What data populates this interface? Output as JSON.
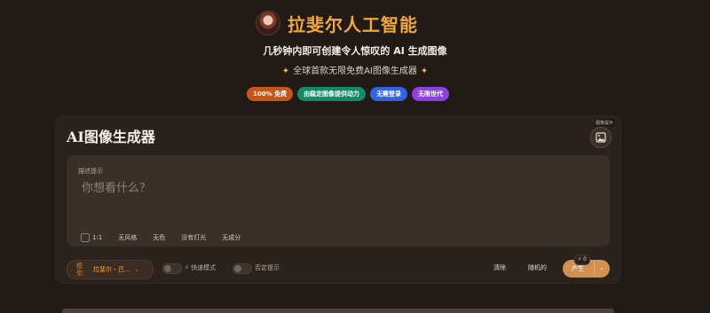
{
  "header": {
    "title": "拉斐尔人工智能",
    "tagline": "几秒钟内即可创建令人惊叹的 AI 生成图像",
    "subtitle": "全球首款无限免费AI图像生成器",
    "badges": [
      {
        "label": "100% 免费",
        "color": "#c4561a"
      },
      {
        "label": "由稳定图像提供动力",
        "color": "#118a65"
      },
      {
        "label": "无需登录",
        "color": "#2f63e0"
      },
      {
        "label": "无限世代",
        "color": "#8d3fe0"
      }
    ]
  },
  "generator": {
    "title": "AI图像生成器",
    "image_button_label": "图像提示",
    "prompt_label": "描述提示",
    "prompt_placeholder": "你想看什么？",
    "prompt_value": "",
    "options": [
      "1:1",
      "无风格",
      "无色",
      "没有灯光",
      "无成分"
    ],
    "model_label": "模型:",
    "model_value": "拉斐尔・巴…",
    "fast_mode_label": "快速模式",
    "negative_prompt_label": "否定提示",
    "clear_label": "清除",
    "random_label": "随机的",
    "generate_label": "产生",
    "generate_count": "0"
  },
  "icons": {
    "sparkle": "sparkle-icon",
    "image": "image-icon",
    "chevron": "chevron-down-icon",
    "lightning": "lightning-icon"
  },
  "colors": {
    "background": "#211a16",
    "accent": "#f0a83a",
    "generate": "#d09152"
  }
}
